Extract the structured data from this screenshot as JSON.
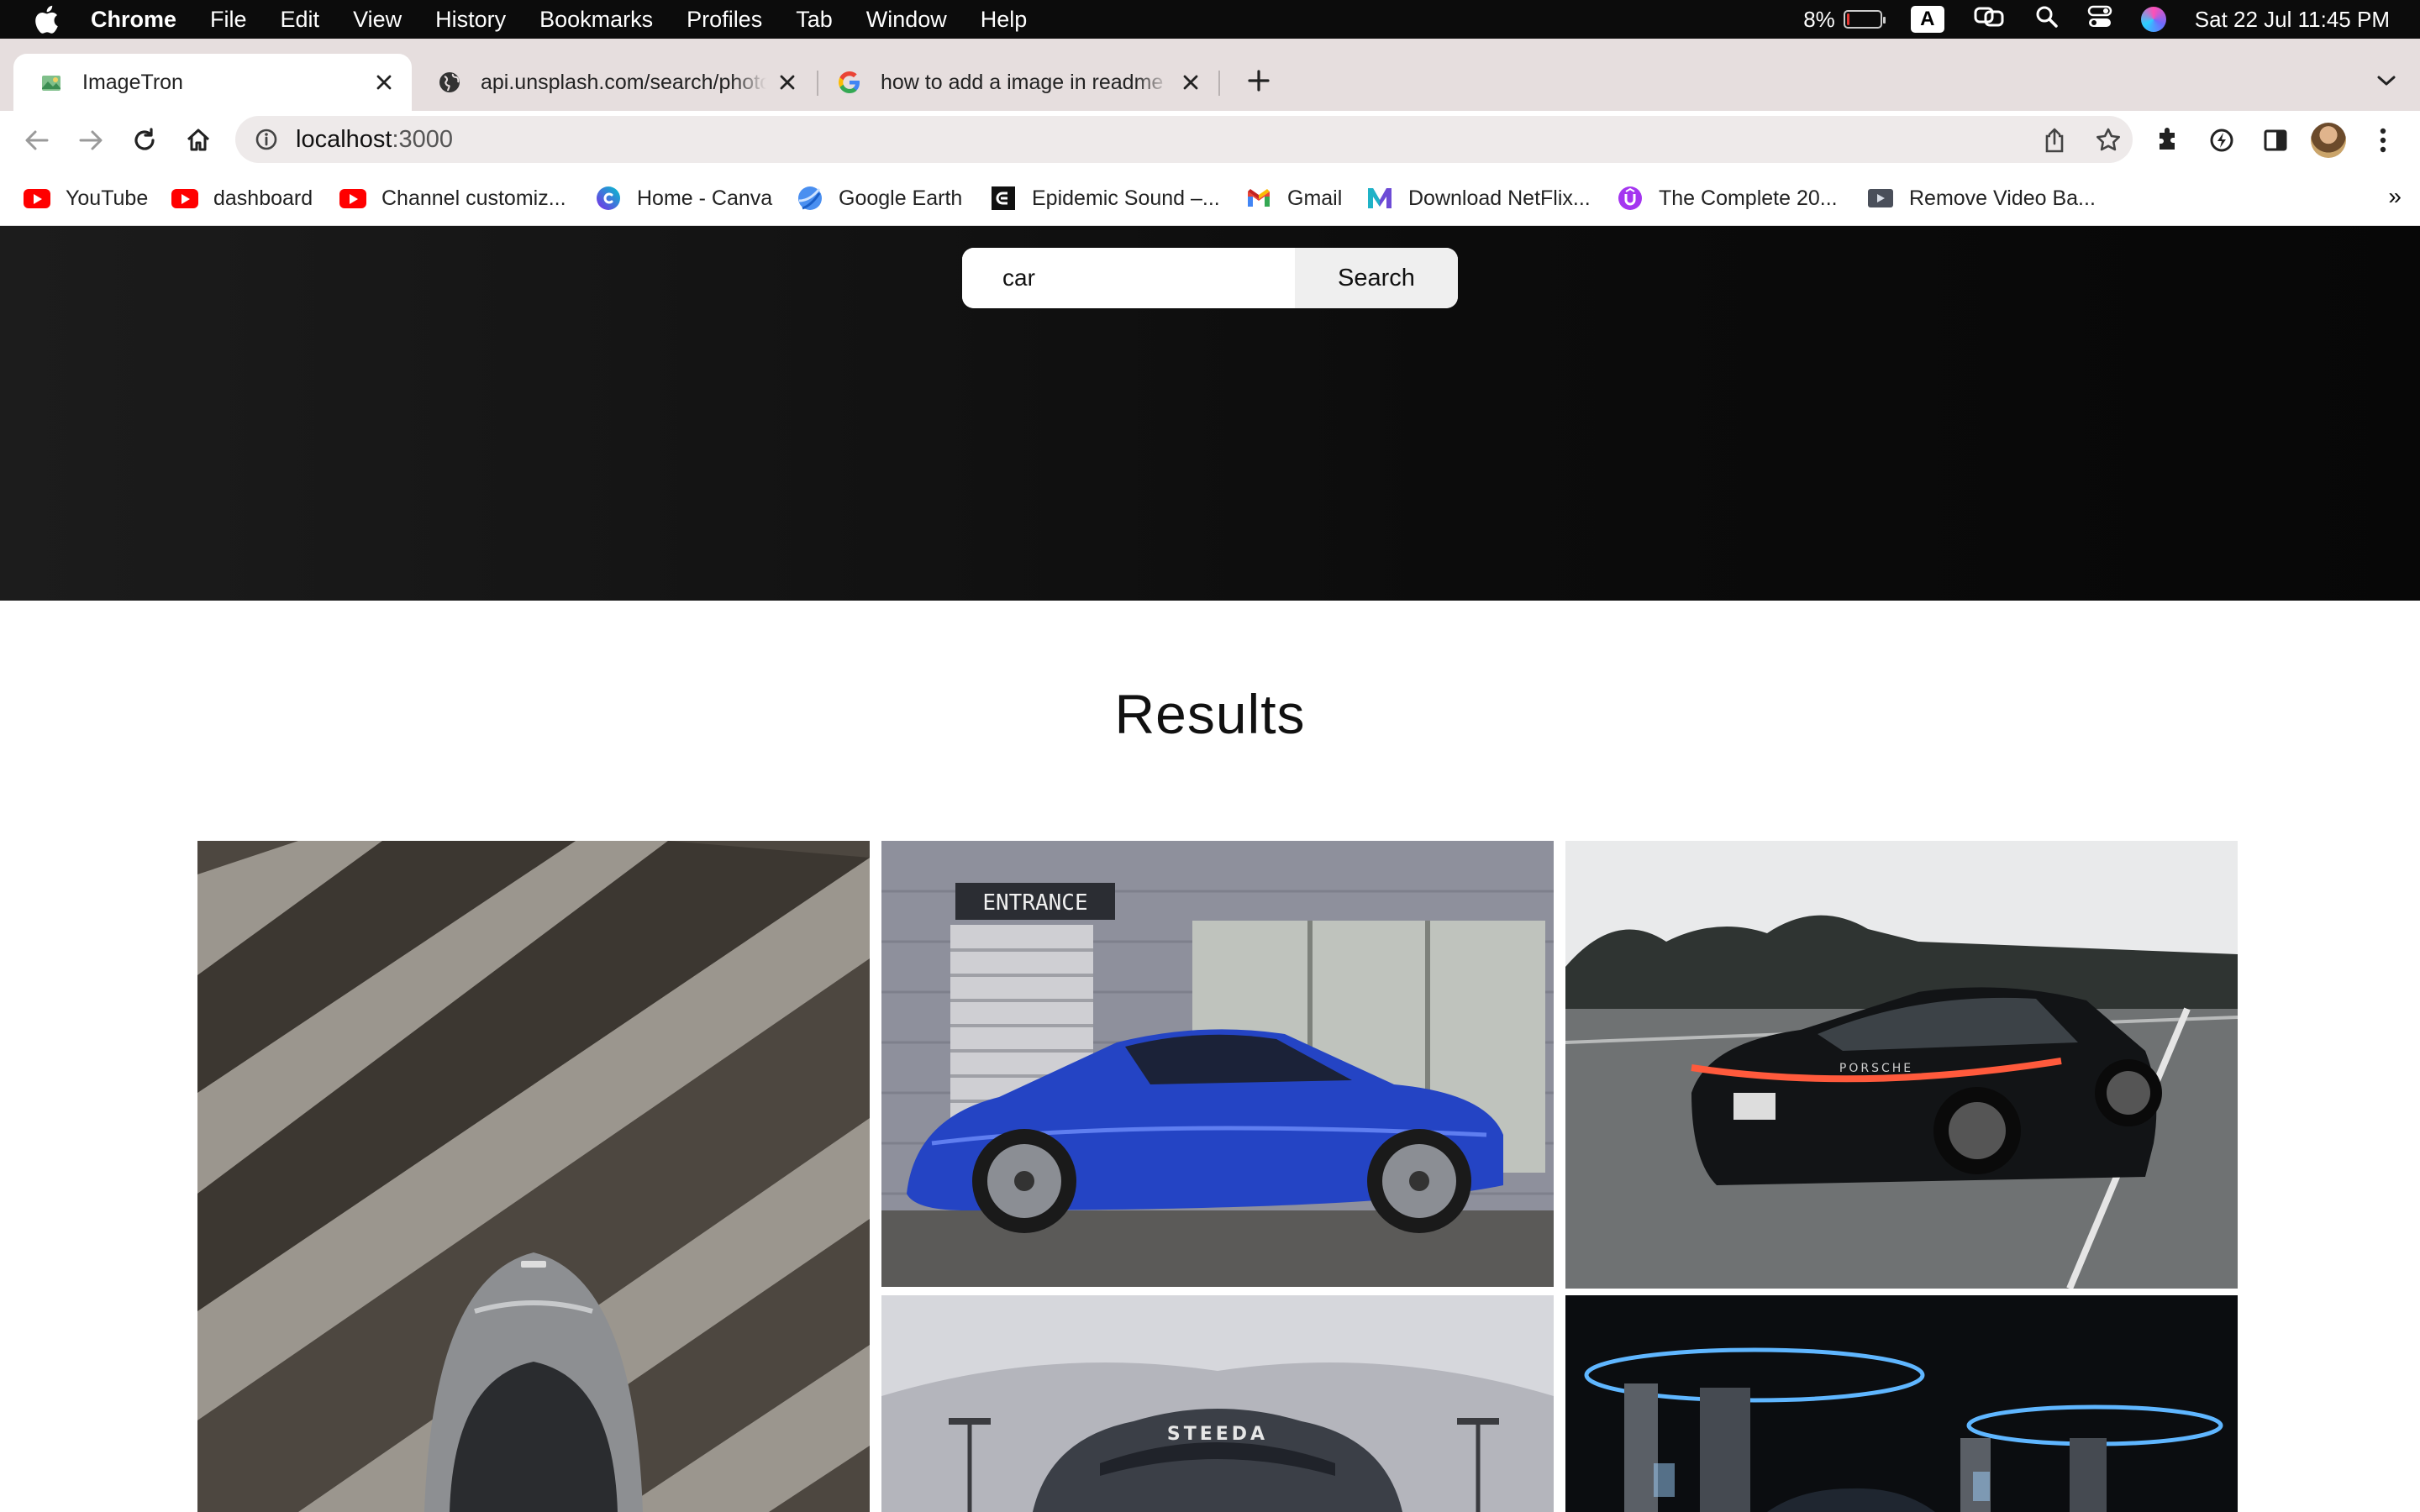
{
  "menubar": {
    "app": "Chrome",
    "items": [
      "File",
      "Edit",
      "View",
      "History",
      "Bookmarks",
      "Profiles",
      "Tab",
      "Window",
      "Help"
    ],
    "battery_percent": "8%",
    "battery_level": 0.08,
    "input_source": "A",
    "datetime": "Sat 22 Jul  11:45 PM"
  },
  "tabs": [
    {
      "title": "ImageTron",
      "icon": "imagetron-favicon",
      "active": true
    },
    {
      "title": "api.unsplash.com/search/photos",
      "icon": "globe-icon",
      "active": false
    },
    {
      "title": "how to add a image in readme file",
      "icon": "google-icon",
      "active": false
    }
  ],
  "address": {
    "host": "localhost",
    "port": ":3000"
  },
  "bookmarks": [
    {
      "label": "YouTube",
      "icon": "youtube-icon"
    },
    {
      "label": "dashboard",
      "icon": "youtube-icon"
    },
    {
      "label": "Channel customiz...",
      "icon": "youtube-icon"
    },
    {
      "label": "Home - Canva",
      "icon": "canva-icon"
    },
    {
      "label": "Google Earth",
      "icon": "google-earth-icon"
    },
    {
      "label": "Epidemic Sound –...",
      "icon": "epidemic-sound-icon"
    },
    {
      "label": "Gmail",
      "icon": "gmail-icon"
    },
    {
      "label": "Download NetFlix...",
      "icon": "m-logo-icon"
    },
    {
      "label": "The Complete 20...",
      "icon": "udemy-icon"
    },
    {
      "label": "Remove Video Ba...",
      "icon": "video-icon"
    }
  ],
  "bookmarks_overflow": "»",
  "search": {
    "value": "car",
    "button_label": "Search"
  },
  "results": {
    "title": "Results",
    "images": [
      {
        "name": "grey-car-top-view-with-shadow-stripes"
      },
      {
        "name": "blue-coupe-at-entrance",
        "sign_text": "ENTRANCE"
      },
      {
        "name": "black-porsche-on-highway",
        "badge_text": "PORSCHE"
      },
      {
        "name": "grey-mustang-front-view",
        "badge_text": "STEEDA"
      },
      {
        "name": "car-at-charging-station"
      }
    ]
  },
  "colors": {
    "hero_bg": "#0f0f0f",
    "tab_strip": "#e6dede",
    "omnibox": "#eeeaea",
    "search_button": "#efefef"
  }
}
